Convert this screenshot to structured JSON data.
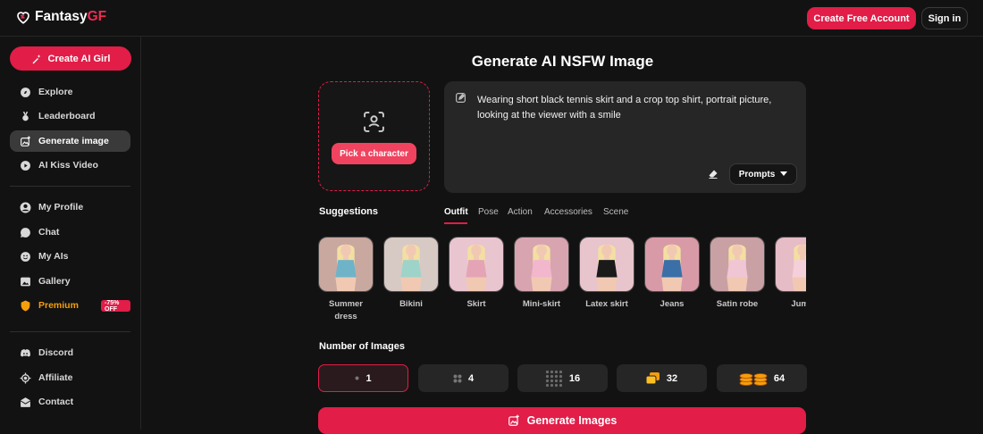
{
  "header": {
    "logo_text": "Fantasy",
    "logo_accent": "GF",
    "create_account_label": "Create Free Account",
    "signin_label": "Sign in"
  },
  "sidebar": {
    "create_label": "Create AI Girl",
    "items": [
      {
        "label": "Explore",
        "icon": "compass-icon"
      },
      {
        "label": "Leaderboard",
        "icon": "medal-icon"
      },
      {
        "label": "Generate image",
        "icon": "image-plus-icon",
        "active": true
      },
      {
        "label": "AI Kiss Video",
        "icon": "video-icon"
      },
      {
        "label": "My Profile",
        "icon": "user-icon"
      },
      {
        "label": "Chat",
        "icon": "chat-icon"
      },
      {
        "label": "My AIs",
        "icon": "smile-icon"
      },
      {
        "label": "Gallery",
        "icon": "gallery-icon"
      },
      {
        "label": "Premium",
        "icon": "shield-icon",
        "badge": "-75% OFF"
      },
      {
        "label": "Discord",
        "icon": "discord-icon"
      },
      {
        "label": "Affiliate",
        "icon": "target-icon"
      },
      {
        "label": "Contact",
        "icon": "mail-icon"
      }
    ]
  },
  "main": {
    "title": "Generate AI NSFW Image",
    "pick_label": "Pick a character",
    "prompt_text": "Wearing short black tennis skirt and a crop top shirt, portrait picture, looking at the viewer with a smile",
    "prompts_label": "Prompts",
    "suggestions_title": "Suggestions",
    "tabs": [
      "Outfit",
      "Pose",
      "Action",
      "Accessories",
      "Scene"
    ],
    "active_tab": "Outfit",
    "suggestions": [
      {
        "label": "Summer dress",
        "bg": "#c9a8a0",
        "outfit": "#6fb3c9"
      },
      {
        "label": "Bikini",
        "bg": "#d7c9c4",
        "outfit": "#9ed3c9"
      },
      {
        "label": "Skirt",
        "bg": "#e9c5cf",
        "outfit": "#e5a4b6"
      },
      {
        "label": "Mini-skirt",
        "bg": "#d8a4b0",
        "outfit": "#f2b7cc"
      },
      {
        "label": "Latex skirt",
        "bg": "#e8c4cc",
        "outfit": "#1a1a1a"
      },
      {
        "label": "Jeans",
        "bg": "#d99aa7",
        "outfit": "#3b6fa8"
      },
      {
        "label": "Satin robe",
        "bg": "#c9a0a4",
        "outfit": "#f0c6d5"
      },
      {
        "label": "Jump",
        "bg": "#e6bcc6",
        "outfit": "#f5d0db"
      }
    ],
    "num_title": "Number of Images",
    "num_options": [
      {
        "value": "1",
        "active": true
      },
      {
        "value": "4"
      },
      {
        "value": "16"
      },
      {
        "value": "32"
      },
      {
        "value": "64"
      }
    ],
    "generate_label": "Generate Images"
  },
  "colors": {
    "accent": "#e11d48",
    "background": "#121212",
    "panel": "#262626",
    "premium": "#f59e0b"
  }
}
